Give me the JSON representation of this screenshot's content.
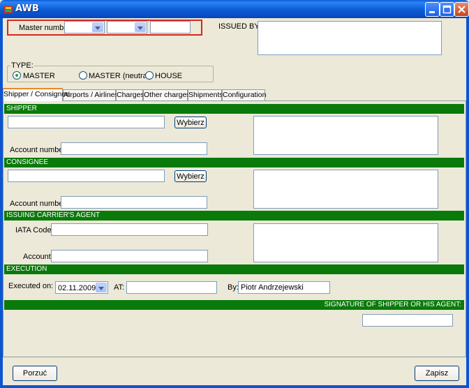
{
  "window": {
    "title": "AWB"
  },
  "header": {
    "master_number_label": "Master number:",
    "master_combo_1": "",
    "master_combo_2": "",
    "master_input": "",
    "issued_by_label": "ISSUED BY:",
    "issued_by_value": ""
  },
  "type": {
    "group_label": "TYPE:",
    "options": [
      {
        "label": "MASTER",
        "selected": true
      },
      {
        "label": "MASTER (neutral)",
        "selected": false
      },
      {
        "label": "HOUSE",
        "selected": false
      }
    ]
  },
  "tabs": [
    {
      "label": "Shipper / Consignee",
      "active": true
    },
    {
      "label": "Airports / Airlines",
      "active": false
    },
    {
      "label": "Charges",
      "active": false
    },
    {
      "label": "Other charges",
      "active": false
    },
    {
      "label": "Shipments",
      "active": false
    },
    {
      "label": "Configuration",
      "active": false
    }
  ],
  "shipper": {
    "section_title": "SHIPPER",
    "select_button": "Wybierz",
    "account_label": "Account number:",
    "name": "",
    "account": "",
    "address": ""
  },
  "consignee": {
    "section_title": "CONSIGNEE",
    "select_button": "Wybierz",
    "account_label": "Account number:",
    "name": "",
    "account": "",
    "address": ""
  },
  "agent": {
    "section_title": "ISSUING CARRIER'S AGENT",
    "iata_label": "IATA Code:",
    "account_label": "Account:",
    "iata": "",
    "account": "",
    "address": ""
  },
  "execution": {
    "section_title": "EXECUTION",
    "executed_on_label": "Executed on:",
    "executed_on_value": "02.11.2009",
    "at_label": "AT:",
    "at_value": "",
    "by_label": "By:",
    "by_value": "Piotr Andrzejewski"
  },
  "signature": {
    "section_title": "SIGNATURE OF SHIPPER OR HIS AGENT:",
    "value": ""
  },
  "footer": {
    "left_button": "Porzuć",
    "right_button": "Zapisz"
  }
}
